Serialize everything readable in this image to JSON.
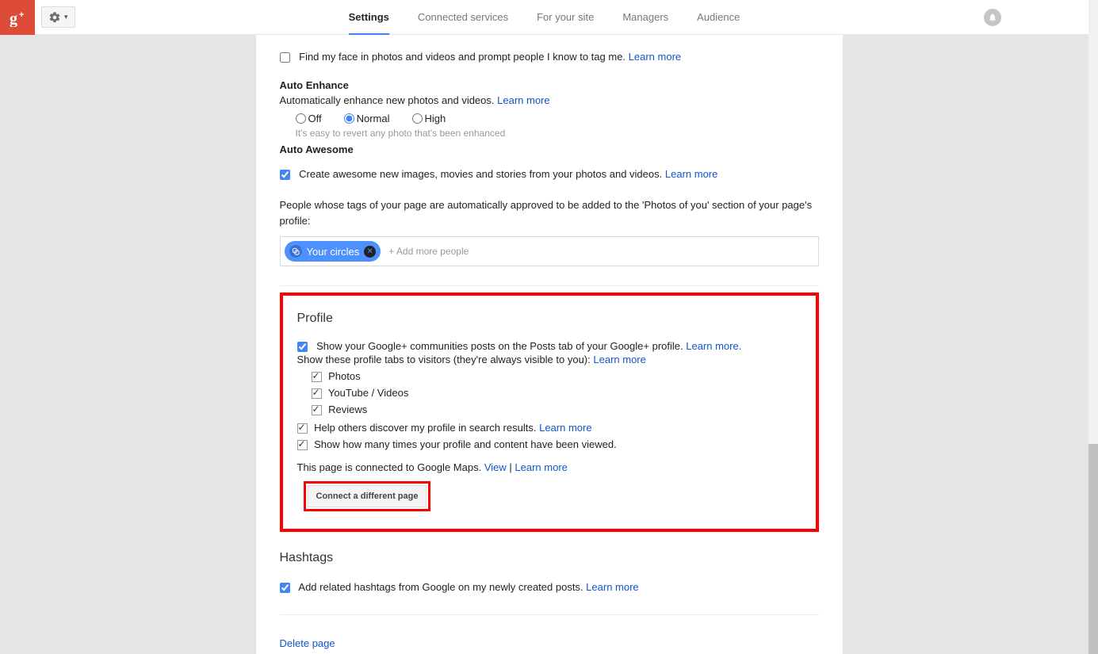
{
  "header": {
    "tabs": [
      "Settings",
      "Connected services",
      "For your site",
      "Managers",
      "Audience"
    ]
  },
  "photos": {
    "find_face": "Find my face in photos and videos and prompt people I know to tag me.",
    "learn_more": "Learn more",
    "auto_enhance_title": "Auto Enhance",
    "auto_enhance_desc": "Automatically enhance new photos and videos.",
    "opt_off": "Off",
    "opt_normal": "Normal",
    "opt_high": "High",
    "revert_hint": "It's easy to revert any photo that's been enhanced",
    "auto_awesome_title": "Auto Awesome",
    "auto_awesome_desc": "Create awesome new images, movies and stories from your photos and videos.",
    "tags_desc": "People whose tags of your page are automatically approved to be added to the 'Photos of you' section of your page's profile:",
    "chip_label": "Your circles",
    "chip_placeholder": "+ Add more people"
  },
  "profile": {
    "title": "Profile",
    "communities": "Show your Google+ communities posts on the Posts tab of your Google+ profile.",
    "learn_more_dot": "Learn more.",
    "tabs_desc": "Show these profile tabs to visitors (they're always visible to you):",
    "learn_more": "Learn more",
    "tab_photos": "Photos",
    "tab_youtube": "YouTube / Videos",
    "tab_reviews": "Reviews",
    "discover": "Help others discover my profile in search results.",
    "view_count": "Show how many times your profile and content have been viewed.",
    "maps_text": "This page is connected to Google Maps.",
    "view_link": "View",
    "pipe": " | ",
    "connect_btn": "Connect a different page"
  },
  "hashtags": {
    "title": "Hashtags",
    "desc": "Add related hashtags from Google on my newly created posts.",
    "learn_more": "Learn more"
  },
  "delete_page": "Delete page"
}
